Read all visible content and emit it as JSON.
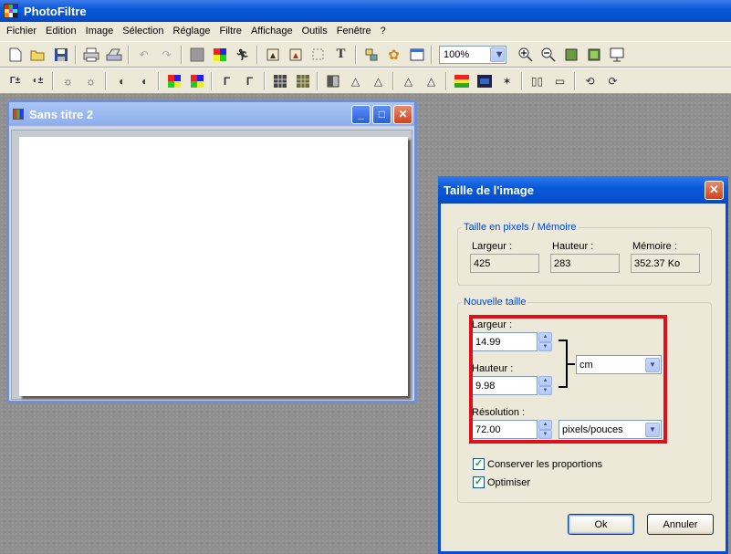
{
  "app": {
    "title": "PhotoFiltre"
  },
  "menu": [
    "Fichier",
    "Edition",
    "Image",
    "Sélection",
    "Réglage",
    "Filtre",
    "Affichage",
    "Outils",
    "Fenêtre",
    "?"
  ],
  "toolbar": {
    "zoom_value": "100%",
    "text_tool_glyph": "T",
    "row1_icons": [
      "new-icon",
      "open-icon",
      "save-icon",
      "print-icon",
      "scan-icon",
      "undo-icon",
      "redo-icon",
      "color-grey-icon",
      "color-palette-icon",
      "transform-icon",
      "crop-icon",
      "resize-icon",
      "select-icon",
      "text-tool-icon",
      "layer-icon",
      "gear-icon",
      "window-icon",
      "zoom-in-icon",
      "zoom-out-icon",
      "fit-image-icon",
      "actual-size-icon",
      "fullscreen-icon"
    ],
    "row2_icons": [
      "auto-levels-icon",
      "auto-contrast-icon",
      "brightness-down-icon",
      "brightness-up-icon",
      "contrast-down-icon",
      "contrast-up-icon",
      "saturation-down-icon",
      "saturation-up-icon",
      "gamma-down-icon",
      "gamma-up-icon",
      "grid-icon",
      "grid-alt-icon",
      "sharpen-icon",
      "blur-icon",
      "drop-icon",
      "blur-more-icon",
      "sharpen-more-icon",
      "color-icon",
      "gradient-icon",
      "effects-icon",
      "mirror-icon",
      "flip-icon",
      "rotate-left-icon",
      "rotate-right-icon"
    ]
  },
  "document": {
    "title": "Sans titre 2"
  },
  "dialog": {
    "title": "Taille de l'image",
    "pixels_group": {
      "legend": "Taille en pixels / Mémoire",
      "width_label": "Largeur :",
      "width_value": "425",
      "height_label": "Hauteur :",
      "height_value": "283",
      "memory_label": "Mémoire :",
      "memory_value": "352.37 Ko"
    },
    "new_size_group": {
      "legend": "Nouvelle taille",
      "width_label": "Largeur :",
      "width_value": "14.99",
      "height_label": "Hauteur :",
      "height_value": "9.98",
      "unit_value": "cm",
      "resolution_label": "Résolution :",
      "resolution_value": "72.00",
      "resolution_unit": "pixels/pouces"
    },
    "keep_proportions": {
      "label": "Conserver les proportions",
      "checked": true
    },
    "optimize": {
      "label": "Optimiser",
      "checked": true
    },
    "ok_label": "Ok",
    "cancel_label": "Annuler"
  },
  "colors": {
    "highlight_box": "#e0101a",
    "xp_blue": "#0a5ad8",
    "legend_blue": "#0046d5"
  }
}
